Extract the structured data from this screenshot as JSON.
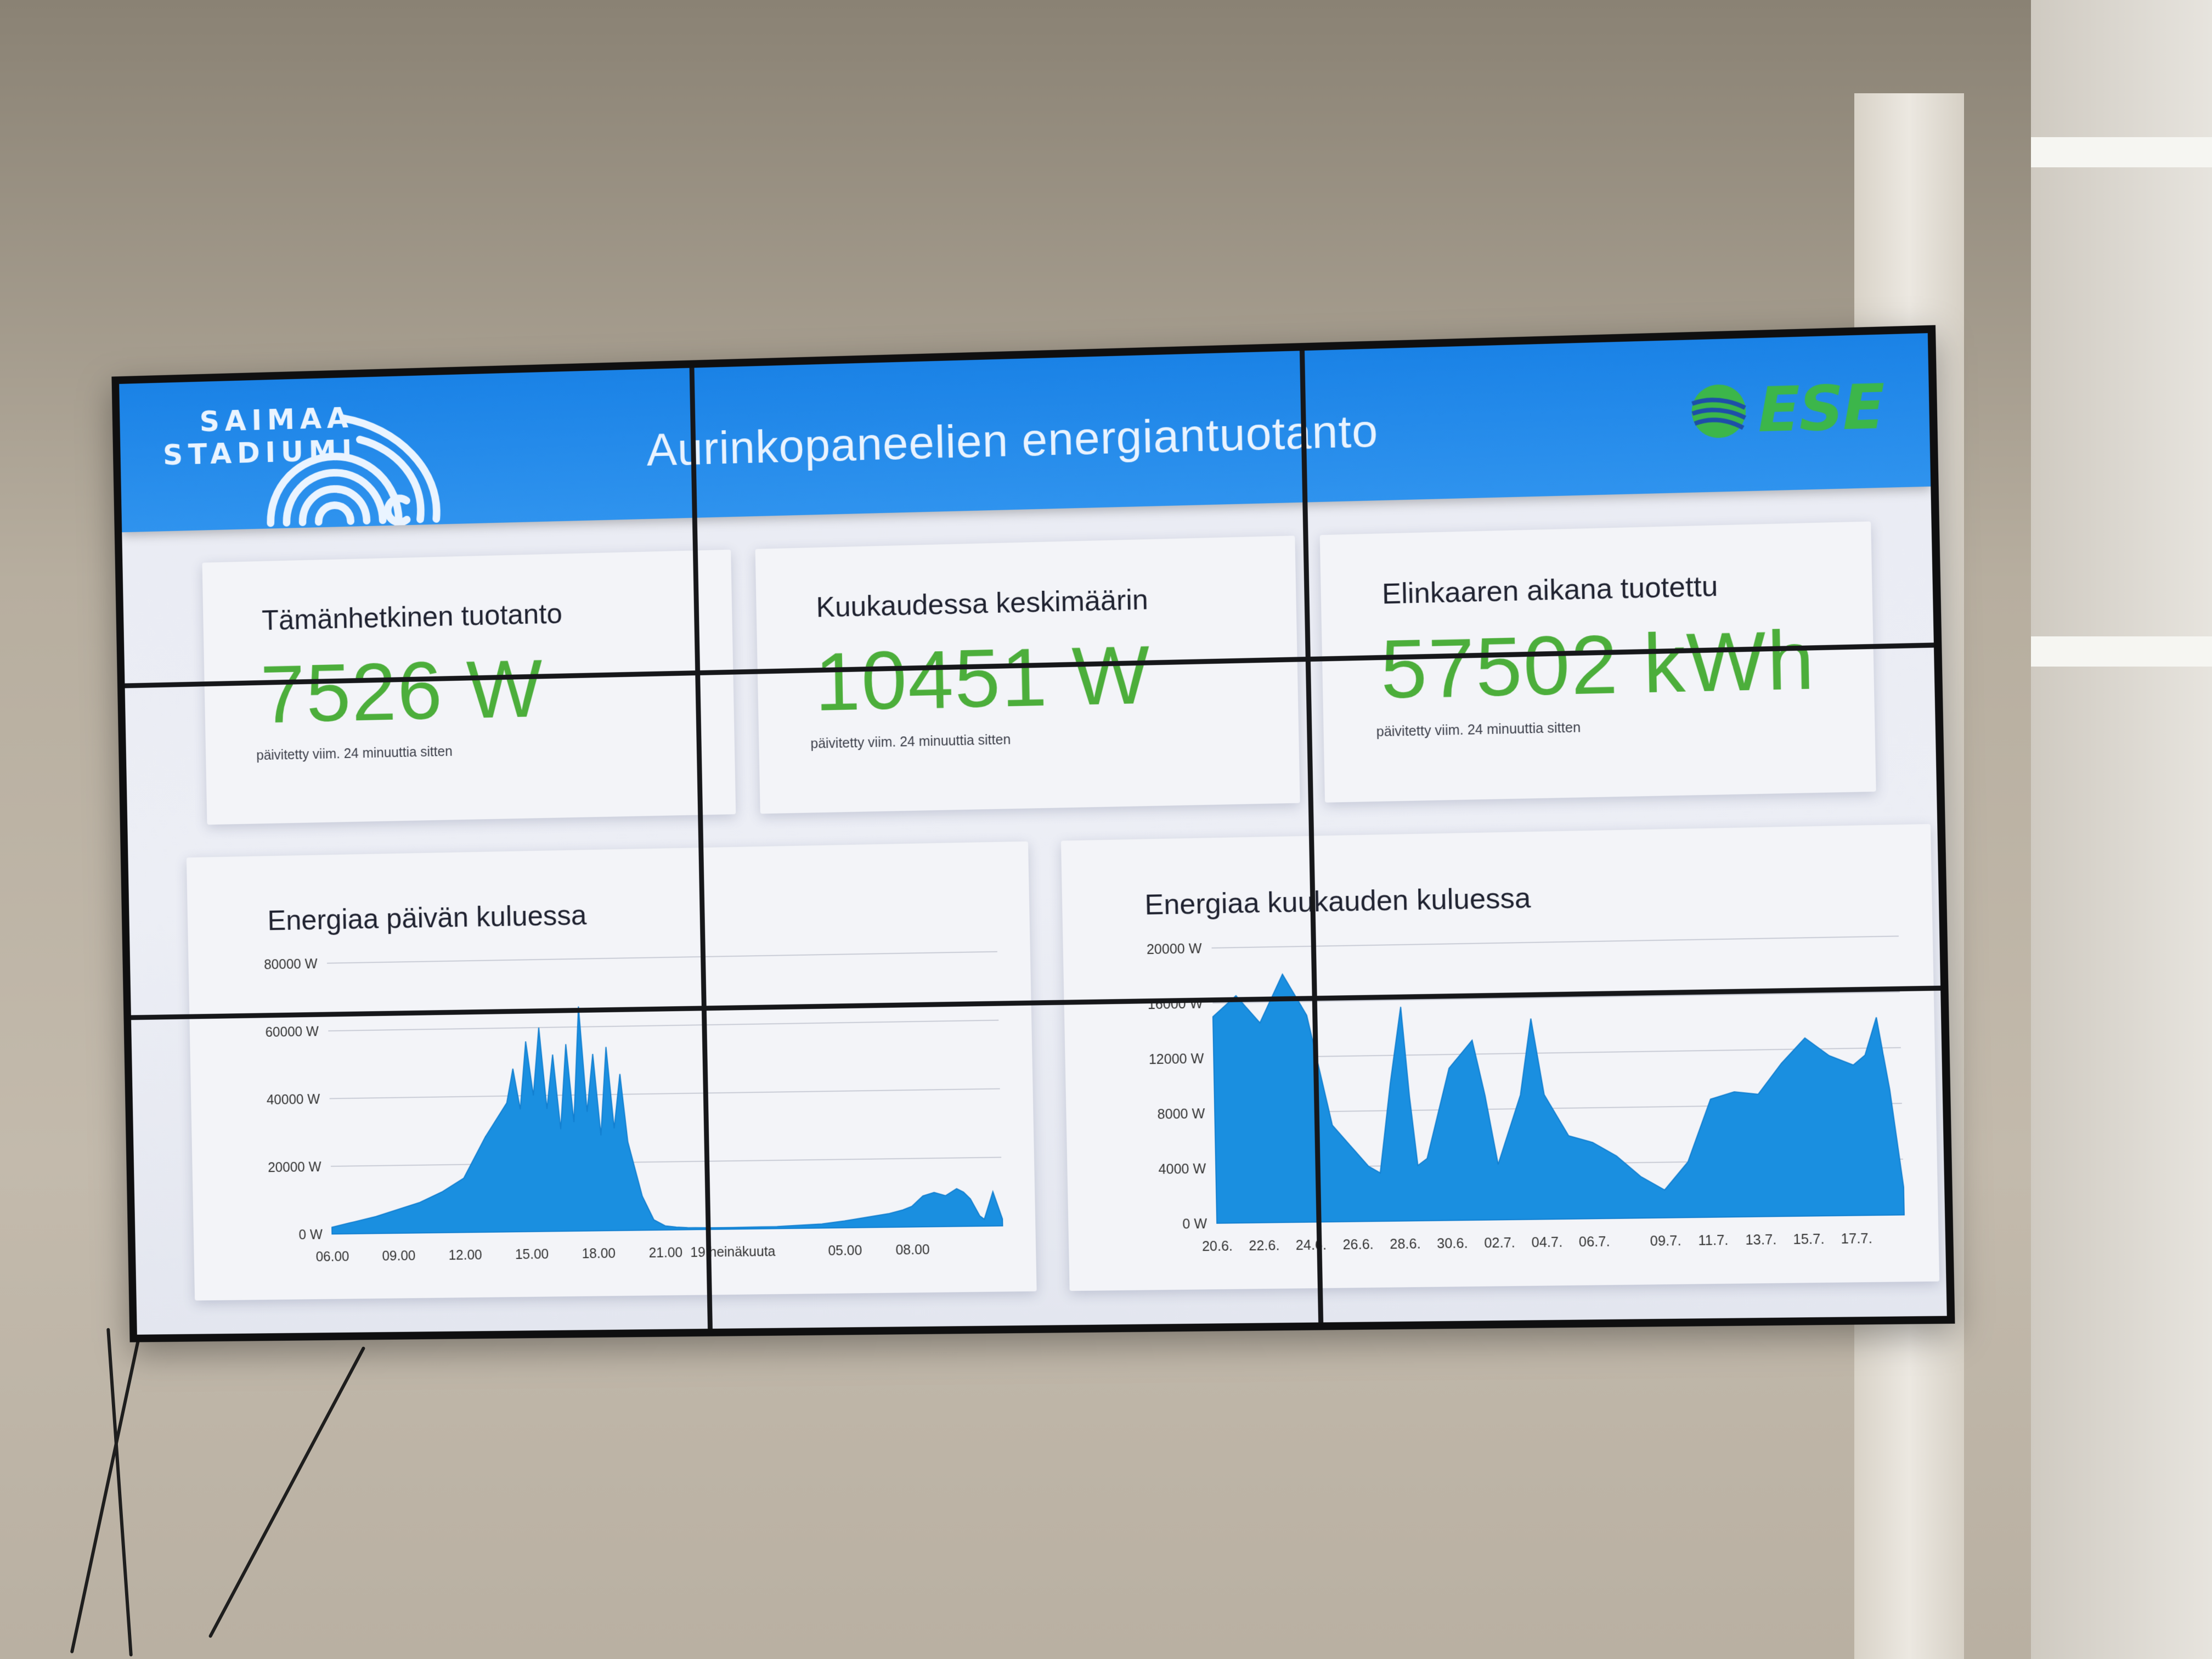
{
  "header": {
    "title": "Aurinkopaneelien energiantuotanto",
    "logo_left": {
      "line1": "SAIMAA",
      "line2": "STADIUMI",
      "icon": "fingerprint-arcs-icon"
    },
    "logo_right": {
      "text": "ESE",
      "icon": "ese-globe-icon"
    }
  },
  "stats": [
    {
      "label": "Tämänhetkinen tuotanto",
      "value": "7526 W",
      "updated": "päivitetty viim. 24 minuuttia sitten"
    },
    {
      "label": "Kuukaudessa keskimäärin",
      "value": "10451 W",
      "updated": "päivitetty viim. 24 minuuttia sitten"
    },
    {
      "label": "Elinkaaren aikana tuotettu",
      "value": "57502 kWh",
      "updated": "päivitetty viim. 24 minuuttia sitten"
    }
  ],
  "colors": {
    "header_blue": "#1a82e6",
    "value_green": "#4cae3b",
    "chart_fill": "#1a8fe0",
    "ese_green": "#3cb64a"
  },
  "chart_data": [
    {
      "type": "area",
      "title": "Energiaa päivän kuluessa",
      "ylim": [
        0,
        80000
      ],
      "yticks": [
        "80000 W",
        "60000 W",
        "40000 W",
        "20000 W",
        "0 W"
      ],
      "ytick_values": [
        80000,
        60000,
        40000,
        20000,
        0
      ],
      "xticks": [
        "06.00",
        "09.00",
        "12.00",
        "15.00",
        "18.00",
        "21.00",
        "19 heinäkuuta",
        "05.00",
        "08.00"
      ],
      "xtick_hours": [
        0,
        3,
        6,
        9,
        12,
        15,
        18,
        23,
        26
      ],
      "xlim_hours": [
        0,
        30
      ],
      "x_hours": [
        0,
        1,
        2,
        3,
        4,
        5,
        6,
        6.5,
        7,
        7.5,
        8,
        8.3,
        8.6,
        8.9,
        9.2,
        9.5,
        9.8,
        10.1,
        10.4,
        10.7,
        11.0,
        11.3,
        11.6,
        11.9,
        12.2,
        12.5,
        12.8,
        13.1,
        13.4,
        14,
        14.5,
        15,
        15.5,
        16,
        17,
        18,
        20,
        22,
        23,
        24,
        25,
        25.6,
        26,
        26.5,
        27,
        27.5,
        28,
        28.3,
        28.6,
        29,
        29.2,
        29.4,
        29.6,
        30
      ],
      "values": [
        2000,
        3500,
        5000,
        7000,
        9000,
        12000,
        16000,
        22000,
        28000,
        33000,
        38000,
        48000,
        36000,
        56000,
        40000,
        60000,
        36000,
        52000,
        30000,
        55000,
        32000,
        66000,
        35000,
        52000,
        28000,
        54000,
        30000,
        46000,
        26000,
        10000,
        3000,
        1200,
        800,
        600,
        500,
        500,
        600,
        1200,
        2000,
        3000,
        4000,
        5000,
        6000,
        9000,
        10000,
        9000,
        11000,
        10000,
        8000,
        3000,
        2000,
        6000,
        10000,
        2000
      ]
    },
    {
      "type": "area",
      "title": "Energiaa kuukauden kuluessa",
      "ylim": [
        0,
        20000
      ],
      "yticks": [
        "20000 W",
        "16000 W",
        "12000 W",
        "8000 W",
        "4000 W",
        "0 W"
      ],
      "ytick_values": [
        20000,
        16000,
        12000,
        8000,
        4000,
        0
      ],
      "xticks": [
        "20.6.",
        "22.6.",
        "24.6.",
        "26.6.",
        "28.6.",
        "30.6.",
        "02.7.",
        "04.7.",
        "06.7.",
        "09.7.",
        "11.7.",
        "13.7.",
        "15.7.",
        "17.7."
      ],
      "xtick_days": [
        0,
        2,
        4,
        6,
        8,
        10,
        12,
        14,
        16,
        19,
        21,
        23,
        25,
        27
      ],
      "xlim_days": [
        0,
        29
      ],
      "x_days": [
        0,
        1,
        2,
        3,
        4,
        5,
        6,
        6.5,
        7,
        7.5,
        8,
        8.3,
        8.6,
        9,
        10,
        11,
        11.5,
        12,
        13,
        13.5,
        14,
        15,
        16,
        17,
        18,
        19,
        20,
        21,
        22,
        23,
        24,
        25,
        26,
        27,
        27.5,
        28,
        28.5,
        29
      ],
      "values": [
        15000,
        16500,
        14500,
        18000,
        15000,
        7000,
        5000,
        4000,
        3500,
        10000,
        15500,
        9000,
        4000,
        4500,
        11000,
        13000,
        9000,
        4000,
        9000,
        14500,
        9000,
        6000,
        5500,
        4500,
        3000,
        2000,
        4000,
        8500,
        9000,
        8800,
        11000,
        12800,
        11500,
        10800,
        11500,
        14200,
        9000,
        2000
      ]
    }
  ]
}
